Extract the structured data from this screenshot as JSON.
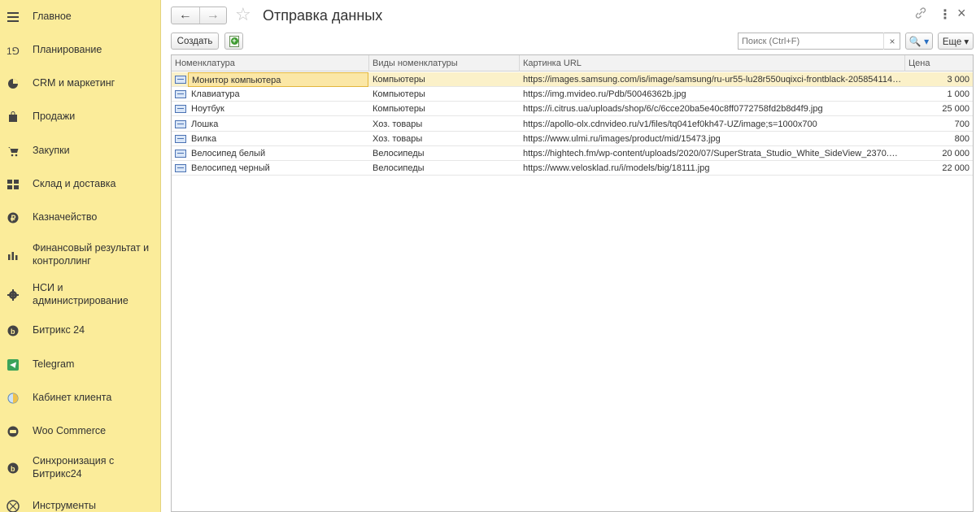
{
  "sidebar": {
    "items": [
      {
        "label": "Главное",
        "icon": "menu-icon"
      },
      {
        "label": "Планирование",
        "icon": "planning-icon"
      },
      {
        "label": "CRM и маркетинг",
        "icon": "pie-chart-icon"
      },
      {
        "label": "Продажи",
        "icon": "shopping-bag-icon"
      },
      {
        "label": "Закупки",
        "icon": "cart-icon"
      },
      {
        "label": "Склад и доставка",
        "icon": "warehouse-icon"
      },
      {
        "label": "Казначейство",
        "icon": "ruble-icon"
      },
      {
        "label": "Финансовый результат и контроллинг",
        "icon": "bar-chart-icon"
      },
      {
        "label": "НСИ и администрирование",
        "icon": "gear-icon"
      },
      {
        "label": "Битрикс 24",
        "icon": "bitrix-icon"
      },
      {
        "label": "Telegram",
        "icon": "telegram-icon"
      },
      {
        "label": "Кабинет клиента",
        "icon": "half-circle-icon"
      },
      {
        "label": "Woo Commerce",
        "icon": "woo-icon"
      },
      {
        "label": "Синхронизация с Битрикс24",
        "icon": "sync-icon"
      },
      {
        "label": "Инструменты",
        "icon": "tools-icon"
      }
    ]
  },
  "header": {
    "title": "Отправка данных"
  },
  "toolbar": {
    "create_label": "Создать",
    "search_placeholder": "Поиск (Ctrl+F)",
    "clear_symbol": "×",
    "more_label": "Еще ▾",
    "search_symbol": "🔍 ▾"
  },
  "table": {
    "columns": [
      "Номенклатура",
      "Виды номенклатуры",
      "Картинка URL",
      "Цена"
    ],
    "rows": [
      {
        "name": "Монитор компьютера",
        "kind": "Компьютеры",
        "url": "https://images.samsung.com/is/image/samsung/ru-ur55-lu28r550uqixci-frontblack-205854114?$720...",
        "price": "3 000"
      },
      {
        "name": "Клавиатура",
        "kind": "Компьютеры",
        "url": "https://img.mvideo.ru/Pdb/50046362b.jpg",
        "price": "1 000"
      },
      {
        "name": "Ноутбук",
        "kind": "Компьютеры",
        "url": "https://i.citrus.ua/uploads/shop/6/c/6cce20ba5e40c8ff0772758fd2b8d4f9.jpg",
        "price": "25 000"
      },
      {
        "name": "Лошка",
        "kind": "Хоз. товары",
        "url": "https://apollo-olx.cdnvideo.ru/v1/files/tq041ef0kh47-UZ/image;s=1000x700",
        "price": "700"
      },
      {
        "name": "Вилка",
        "kind": "Хоз. товары",
        "url": "https://www.ulmi.ru/images/product/mid/15473.jpg",
        "price": "800"
      },
      {
        "name": "Велосипед белый",
        "kind": "Велосипеды",
        "url": "https://hightech.fm/wp-content/uploads/2020/07/SuperStrata_Studio_White_SideView_2370.0-131...",
        "price": "20 000"
      },
      {
        "name": "Велосипед черный",
        "kind": "Велосипеды",
        "url": "https://www.velosklad.ru/i/models/big/18111.jpg",
        "price": "22 000"
      }
    ]
  },
  "colors": {
    "sidebar_bg": "#fbec9a",
    "selected_row": "#fbf1c9",
    "accent": "#2a6fc1"
  }
}
